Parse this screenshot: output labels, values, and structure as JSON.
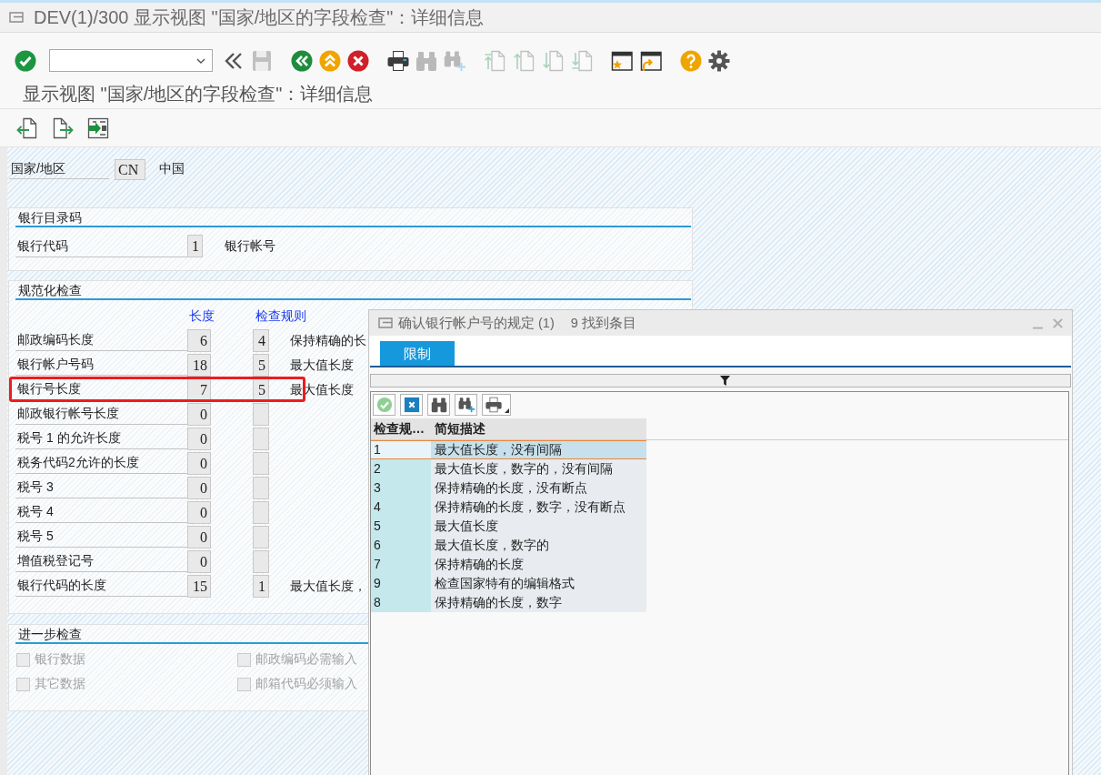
{
  "window": {
    "title": "DEV(1)/300 显示视图 \"国家/地区的字段检查\"：详细信息"
  },
  "toolbar": {
    "groups": [
      {
        "buttons": [
          {
            "kind": "enter",
            "disabled": false
          }
        ]
      },
      {
        "buttons": [
          {
            "kind": "history",
            "disabled": false
          },
          {
            "kind": "save",
            "disabled": true
          }
        ]
      },
      {
        "buttons": [
          {
            "kind": "back",
            "disabled": false
          },
          {
            "kind": "exit",
            "disabled": false
          },
          {
            "kind": "cancel",
            "disabled": false
          }
        ]
      },
      {
        "buttons": [
          {
            "kind": "print",
            "disabled": false
          },
          {
            "kind": "find",
            "disabled": true
          },
          {
            "kind": "findnext",
            "disabled": true
          }
        ]
      },
      {
        "buttons": [
          {
            "kind": "firstpage",
            "disabled": true
          },
          {
            "kind": "prevpage",
            "disabled": true
          },
          {
            "kind": "nextpage",
            "disabled": true
          },
          {
            "kind": "lastpage",
            "disabled": true
          }
        ]
      },
      {
        "buttons": [
          {
            "kind": "newsession",
            "disabled": false
          },
          {
            "kind": "shortcut",
            "disabled": false
          }
        ]
      },
      {
        "buttons": [
          {
            "kind": "help",
            "disabled": false
          },
          {
            "kind": "settings",
            "disabled": false
          }
        ]
      }
    ]
  },
  "screen_title": "显示视图 \"国家/地区的字段检查\"：详细信息",
  "country": {
    "label": "国家/地区",
    "value": "CN",
    "name": "中国"
  },
  "bank_directory": {
    "title": "银行目录码",
    "rows": [
      {
        "label": "银行代码",
        "value": "1",
        "description": "银行帐号"
      }
    ]
  },
  "normalization_check": {
    "title": "规范化检查",
    "columns": [
      "长度",
      "检查规则"
    ],
    "rows": [
      {
        "label": "邮政编码长度",
        "length": "6",
        "rule": "4",
        "description": "保持精确的长",
        "highlighted": false
      },
      {
        "label": "银行帐户号码",
        "length": "18",
        "rule": "5",
        "description": "最大值长度",
        "highlighted": false
      },
      {
        "label": "银行号长度",
        "length": "7",
        "rule": "5",
        "description": "最大值长度",
        "highlighted": true
      },
      {
        "label": "邮政银行帐号长度",
        "length": "0",
        "highlighted": false
      },
      {
        "label": "税号 1 的允许长度",
        "length": "0",
        "highlighted": false
      },
      {
        "label": "税务代码2允许的长度",
        "length": "0",
        "highlighted": false
      },
      {
        "label": "税号 3",
        "length": "0",
        "highlighted": false
      },
      {
        "label": "税号 4",
        "length": "0",
        "highlighted": false
      },
      {
        "label": "税号 5",
        "length": "0",
        "highlighted": false
      },
      {
        "label": "增值税登记号",
        "length": "0",
        "highlighted": false
      },
      {
        "label": "银行代码的长度",
        "length": "15",
        "rule": "1",
        "description": "最大值长度，",
        "highlighted": false
      }
    ]
  },
  "further_check": {
    "title": "进一步检查",
    "options": [
      {
        "label": "银行数据",
        "checked": false,
        "disabled": true
      },
      {
        "label": "邮政编码必需输入",
        "checked": false,
        "disabled": true
      },
      {
        "label": "其它数据",
        "checked": false,
        "disabled": true
      },
      {
        "label": "邮箱代码必须输入",
        "checked": false,
        "disabled": true
      }
    ]
  },
  "dialog": {
    "title": "确认银行帐户号的规定 (1)",
    "hit_count": "9 找到条目",
    "tabs": [
      {
        "label": "限制",
        "selected": true
      }
    ],
    "table": {
      "columns": [
        "检查规…",
        "简短描述"
      ],
      "rows": [
        {
          "cells": [
            "1",
            "最大值长度，没有间隔"
          ],
          "selected": true
        },
        {
          "cells": [
            "2",
            "最大值长度，数字的，没有间隔"
          ],
          "selected": false
        },
        {
          "cells": [
            "3",
            "保持精确的长度，没有断点"
          ],
          "selected": false
        },
        {
          "cells": [
            "4",
            "保持精确的长度，数字，没有断点"
          ],
          "selected": false
        },
        {
          "cells": [
            "5",
            "最大值长度"
          ],
          "selected": false
        },
        {
          "cells": [
            "6",
            "最大值长度，数字的"
          ],
          "selected": false
        },
        {
          "cells": [
            "7",
            "保持精确的长度"
          ],
          "selected": false
        },
        {
          "cells": [
            "9",
            "检查国家特有的编辑格式"
          ],
          "selected": false
        },
        {
          "cells": [
            "8",
            "保持精确的长度，数字"
          ],
          "selected": false
        }
      ]
    }
  }
}
